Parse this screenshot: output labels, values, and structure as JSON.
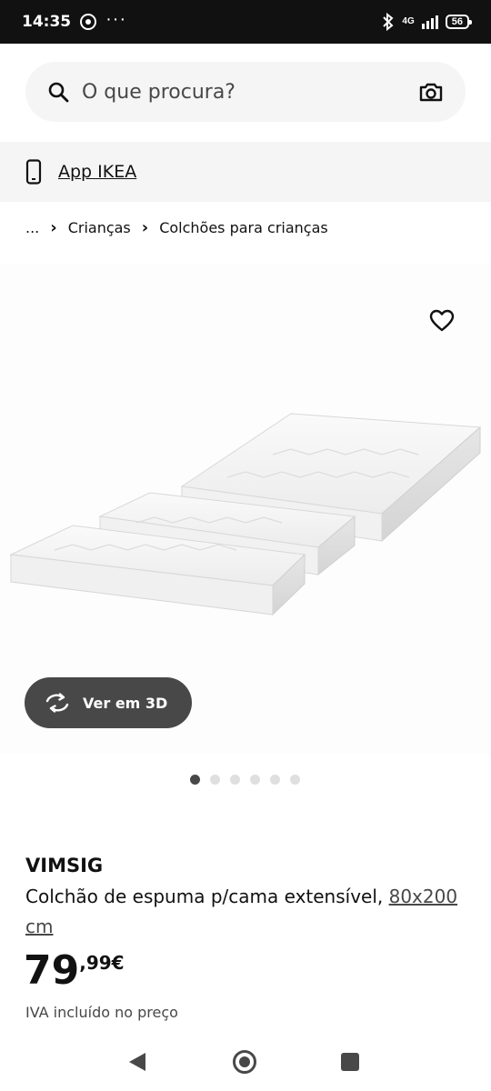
{
  "status_bar": {
    "time": "14:35",
    "more": "···",
    "network": "4G",
    "battery": "56"
  },
  "search": {
    "placeholder": "O que procura?"
  },
  "app_banner": {
    "label": "App IKEA"
  },
  "breadcrumb": {
    "ellipsis": "...",
    "items": [
      "Crianças",
      "Colchões para crianças"
    ]
  },
  "gallery": {
    "view_3d_label": "Ver em 3D",
    "image_count": 6,
    "active_index": 0
  },
  "product": {
    "name": "VIMSIG",
    "description": "Colchão de espuma p/cama extensível, ",
    "size": "80x200 cm",
    "price_int": "79",
    "price_dec": ",99€",
    "vat_note": "IVA incluído no preço"
  },
  "colors": {
    "status_bg": "#111111",
    "pill_bg": "#484848",
    "surface_gray": "#f5f5f5"
  }
}
